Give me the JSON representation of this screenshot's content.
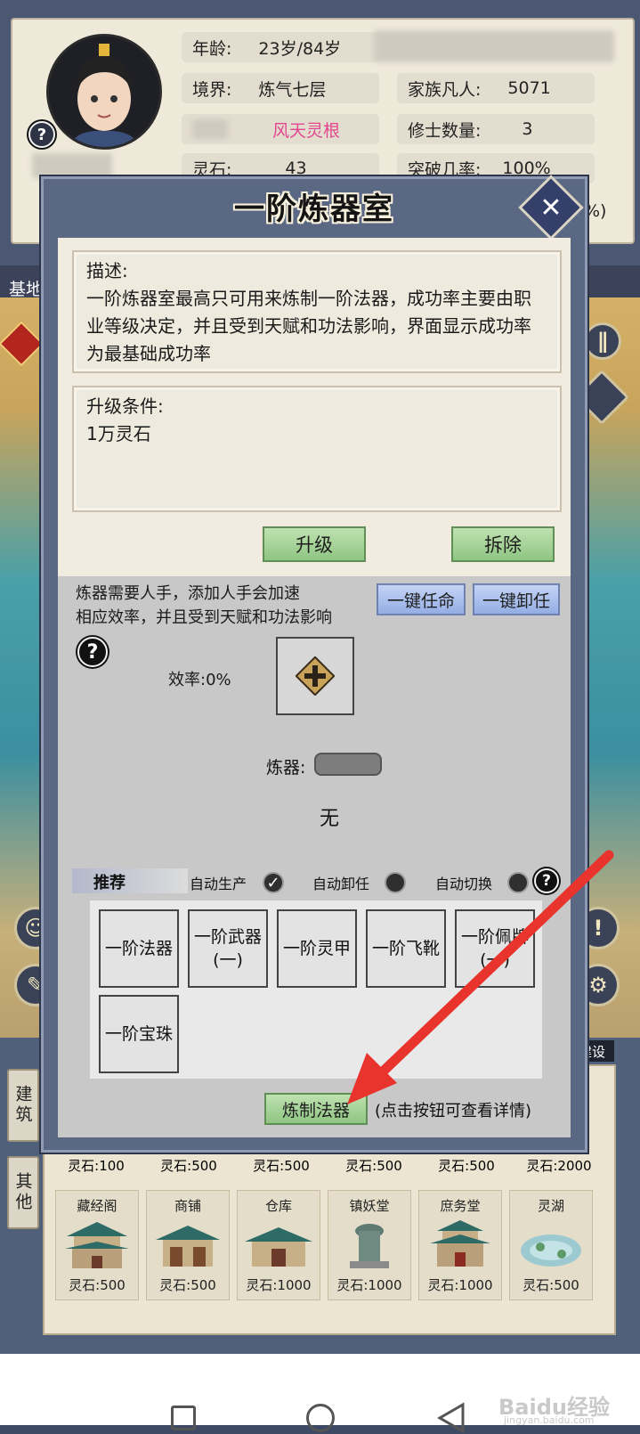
{
  "stats": {
    "age_label": "年龄:",
    "age_value": "23岁/84岁",
    "realm_label": "境界:",
    "realm_value": "炼气七层",
    "root_value": "风天灵根",
    "stone_label": "灵石:",
    "stone_value": "43",
    "mortals_label": "家族凡人:",
    "mortals_value": "5071",
    "cultivators_label": "修士数量:",
    "cultivators_value": "3",
    "breakthrough_label": "突破几率:",
    "breakthrough_value": "100%",
    "extra_percent": "%)"
  },
  "map": {
    "tab_label": "基地"
  },
  "side_tabs": {
    "build": "建筑",
    "other": "其他",
    "build_small": "建设"
  },
  "modal": {
    "title": "一阶炼器室",
    "description_title": "描述:",
    "description_text": "一阶炼器室最高只可用来炼制一阶法器，成功率主要由职业等级决定，并且受到天赋和功法影响，界面显示成功率为最基础成功率",
    "upgrade_title": "升级条件:",
    "upgrade_text": "1万灵石",
    "upgrade_button": "升级",
    "demolish_button": "拆除",
    "staff_line1": "炼器需要人手，添加人手会加速",
    "staff_line2": "相应效率，并且受到天赋和功法影响",
    "appoint_all": "一键任命",
    "dismiss_all": "一键卸任",
    "efficiency": "效率:0%",
    "refine_label": "炼器:",
    "refine_value": "无",
    "recommend_label": "推荐",
    "auto_produce": "自动生产",
    "auto_dismiss": "自动卸任",
    "auto_switch": "自动切换",
    "items": [
      "一阶法器",
      "一阶武器(一)",
      "一阶灵甲",
      "一阶飞靴",
      "一阶佩牌(一)",
      "一阶宝珠"
    ],
    "craft_button": "炼制法器",
    "craft_hint": "(点击按钮可查看详情)"
  },
  "buildings_row1": [
    "灵石:100",
    "灵石:500",
    "灵石:500",
    "灵石:500",
    "灵石:500",
    "灵石:2000"
  ],
  "buildings_row2": [
    {
      "name": "藏经阁",
      "cost": "灵石:500"
    },
    {
      "name": "商铺",
      "cost": "灵石:500"
    },
    {
      "name": "仓库",
      "cost": "灵石:1000"
    },
    {
      "name": "镇妖堂",
      "cost": "灵石:1000"
    },
    {
      "name": "庶务堂",
      "cost": "灵石:1000"
    },
    {
      "name": "灵湖",
      "cost": "灵石:500"
    }
  ],
  "watermark": "Baidu经验",
  "watermark_url": "jingyan.baidu.com",
  "colors": {
    "accent_red": "#e8342c",
    "root_pink": "#e2478f",
    "green_button": "#8fc583",
    "blue_button": "#94aee4"
  }
}
